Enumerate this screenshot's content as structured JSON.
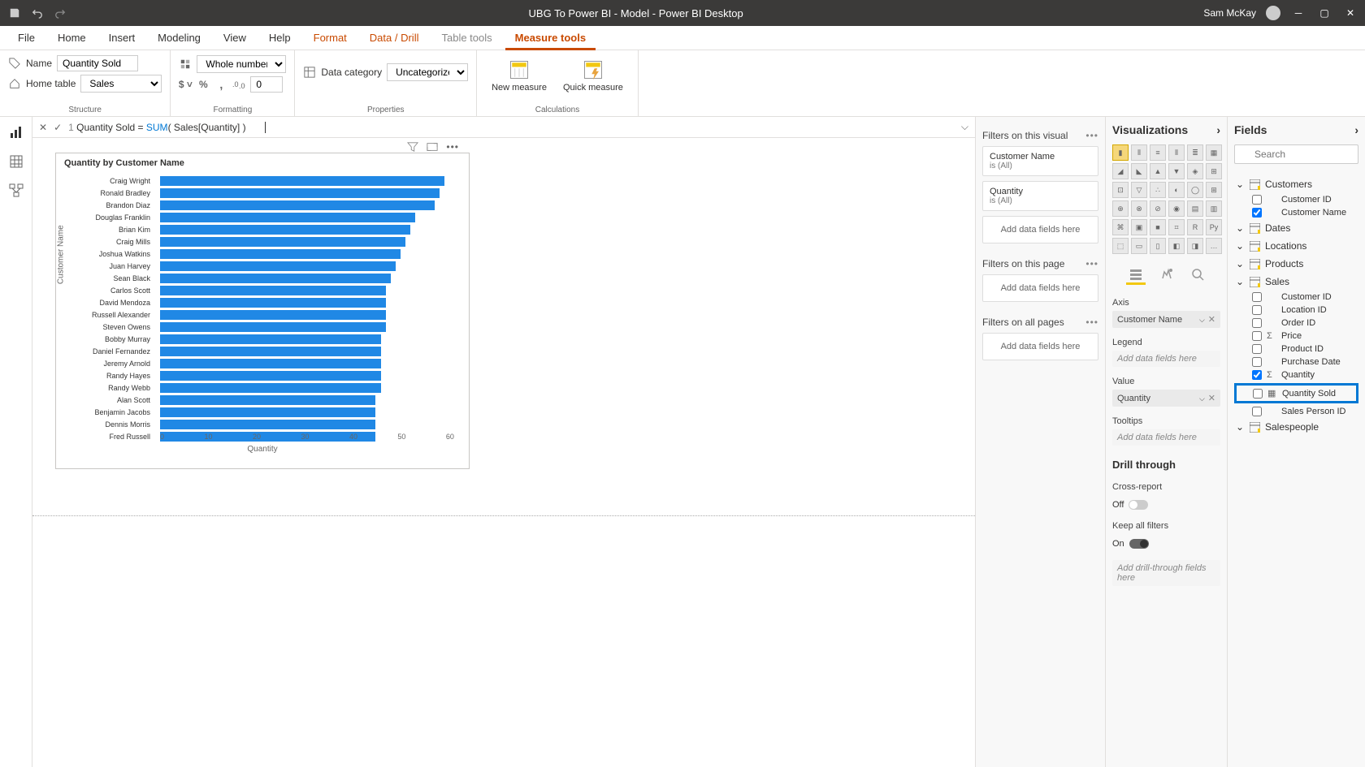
{
  "titlebar": {
    "title": "UBG To Power BI - Model - Power BI Desktop",
    "user": "Sam McKay"
  },
  "ribbon": {
    "tabs": [
      "File",
      "Home",
      "Insert",
      "Modeling",
      "View",
      "Help",
      "Format",
      "Data / Drill",
      "Table tools",
      "Measure tools"
    ],
    "active_tab": "Measure tools",
    "structure": {
      "name_label": "Name",
      "name_value": "Quantity Sold",
      "home_table_label": "Home table",
      "home_table_value": "Sales",
      "group_label": "Structure"
    },
    "formatting": {
      "format_value": "Whole number",
      "decimals": "0",
      "group_label": "Formatting"
    },
    "properties": {
      "label": "Data category",
      "value": "Uncategorized",
      "group_label": "Properties"
    },
    "calculations": {
      "new_measure": "New measure",
      "quick_measure": "Quick measure",
      "group_label": "Calculations"
    }
  },
  "formula": {
    "line_no": "1",
    "measure_name": "Quantity Sold",
    "eq": " = ",
    "func": "SUM",
    "body": "( Sales[Quantity] )"
  },
  "chart": {
    "title": "Quantity by Customer Name",
    "y_axis_title": "Customer Name",
    "x_axis_title": "Quantity",
    "x_ticks": [
      "0",
      "10",
      "20",
      "30",
      "40",
      "50",
      "60"
    ]
  },
  "chart_data": {
    "type": "bar",
    "orientation": "horizontal",
    "title": "Quantity by Customer Name",
    "xlabel": "Quantity",
    "ylabel": "Customer Name",
    "xlim": [
      0,
      60
    ],
    "categories": [
      "Craig Wright",
      "Ronald Bradley",
      "Brandon Diaz",
      "Douglas Franklin",
      "Brian Kim",
      "Craig Mills",
      "Joshua Watkins",
      "Juan Harvey",
      "Sean Black",
      "Carlos Scott",
      "David Mendoza",
      "Russell Alexander",
      "Steven Owens",
      "Bobby Murray",
      "Daniel Fernandez",
      "Jeremy Arnold",
      "Randy Hayes",
      "Randy Webb",
      "Alan Scott",
      "Benjamin Jacobs",
      "Dennis Morris",
      "Fred Russell"
    ],
    "values": [
      58,
      57,
      56,
      52,
      51,
      50,
      49,
      48,
      47,
      46,
      46,
      46,
      46,
      45,
      45,
      45,
      45,
      45,
      44,
      44,
      44,
      44
    ]
  },
  "filters": {
    "visual_header": "Filters on this visual",
    "visual_cards": [
      {
        "name": "Customer Name",
        "state": "is (All)"
      },
      {
        "name": "Quantity",
        "state": "is (All)"
      }
    ],
    "add_visual": "Add data fields here",
    "page_header": "Filters on this page",
    "add_page": "Add data fields here",
    "all_header": "Filters on all pages",
    "add_all": "Add data fields here"
  },
  "viz": {
    "title": "Visualizations",
    "axis_label": "Axis",
    "axis_value": "Customer Name",
    "legend_label": "Legend",
    "legend_placeholder": "Add data fields here",
    "value_label": "Value",
    "value_value": "Quantity",
    "tooltips_label": "Tooltips",
    "tooltips_placeholder": "Add data fields here",
    "drill_header": "Drill through",
    "cross_report_label": "Cross-report",
    "cross_report_state": "Off",
    "keep_filters_label": "Keep all filters",
    "keep_filters_state": "On",
    "drill_placeholder": "Add drill-through fields here"
  },
  "fields": {
    "title": "Fields",
    "search_placeholder": "Search",
    "tables": {
      "customers": {
        "name": "Customers",
        "expanded": true,
        "fields": [
          {
            "name": "Customer ID",
            "checked": false,
            "icon": ""
          },
          {
            "name": "Customer Name",
            "checked": true,
            "icon": ""
          }
        ]
      },
      "dates": {
        "name": "Dates"
      },
      "locations": {
        "name": "Locations"
      },
      "products": {
        "name": "Products"
      },
      "sales": {
        "name": "Sales",
        "expanded": true,
        "fields": [
          {
            "name": "Customer ID",
            "checked": false
          },
          {
            "name": "Location ID",
            "checked": false
          },
          {
            "name": "Order ID",
            "checked": false
          },
          {
            "name": "Price",
            "checked": false,
            "icon": "Σ"
          },
          {
            "name": "Product ID",
            "checked": false
          },
          {
            "name": "Purchase Date",
            "checked": false
          },
          {
            "name": "Quantity",
            "checked": true,
            "icon": "Σ"
          },
          {
            "name": "Quantity Sold",
            "checked": false,
            "icon": "▦",
            "highlight": true
          },
          {
            "name": "Sales Person ID",
            "checked": false
          }
        ]
      },
      "salespeople": {
        "name": "Salespeople"
      }
    }
  }
}
